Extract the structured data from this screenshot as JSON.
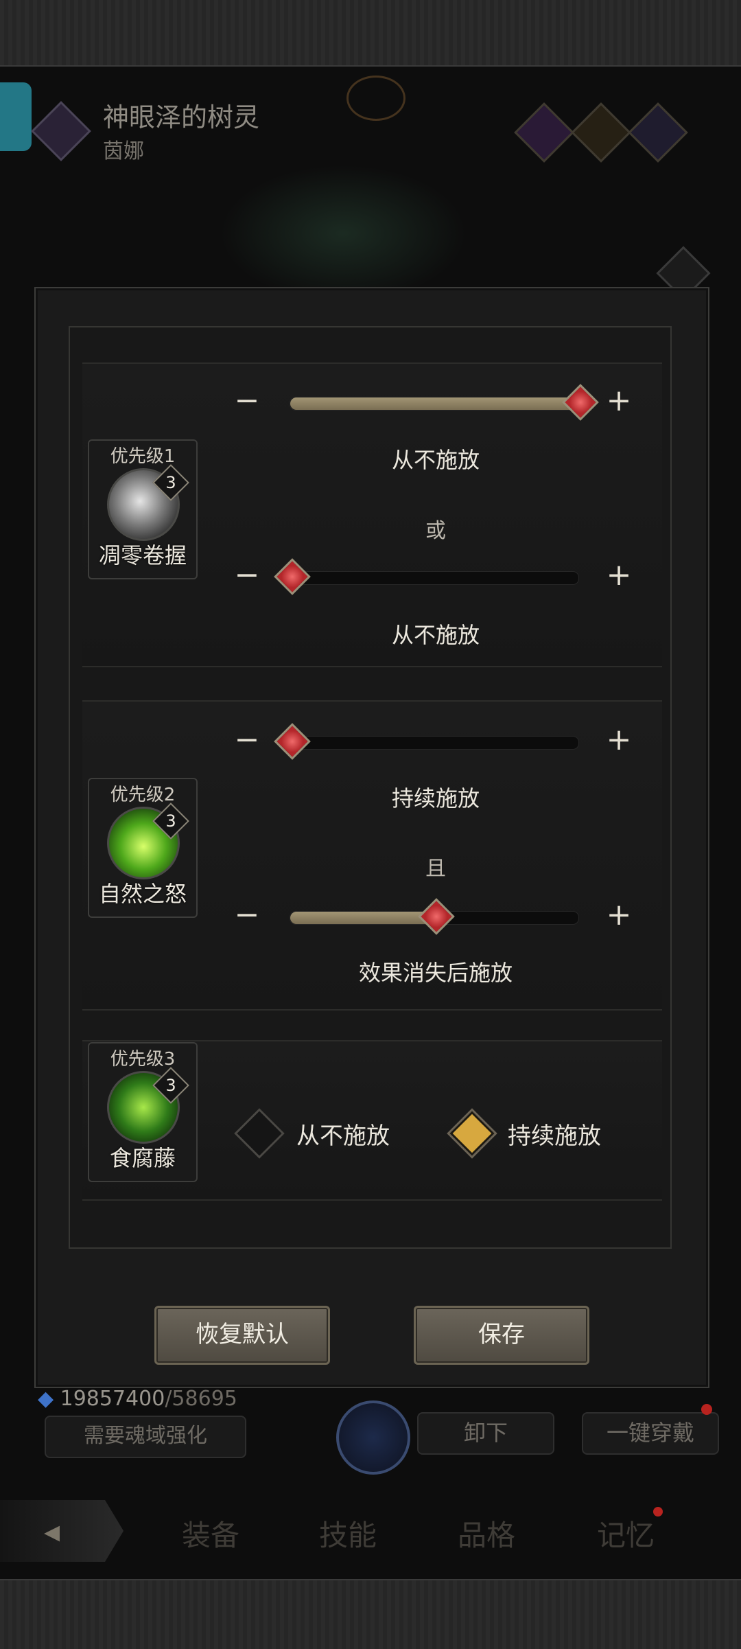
{
  "header": {
    "title": "神眼泽的树灵",
    "subtitle": "茵娜"
  },
  "dialog": {
    "skills": [
      {
        "priority": "优先级1",
        "level": "3",
        "name": "凋零卷握",
        "icon": "withered-grip-skill-icon",
        "slider1": {
          "value_label": "从不施放",
          "position": 1.0
        },
        "connector": "或",
        "slider2": {
          "value_label": "从不施放",
          "position": 0.0
        }
      },
      {
        "priority": "优先级2",
        "level": "3",
        "name": "自然之怒",
        "icon": "natures-wrath-skill-icon",
        "slider1": {
          "value_label": "持续施放",
          "position": 0.0
        },
        "connector": "且",
        "slider2": {
          "value_label": "效果消失后施放",
          "position": 0.5
        }
      },
      {
        "priority": "优先级3",
        "level": "3",
        "name": "食腐藤",
        "icon": "carrion-vine-skill-icon",
        "options": [
          {
            "label": "从不施放",
            "checked": false
          },
          {
            "label": "持续施放",
            "checked": true
          }
        ]
      }
    ],
    "minus_symbol": "−",
    "plus_symbol": "+",
    "reset_label": "恢复默认",
    "save_label": "保存"
  },
  "background": {
    "soul_count": "19857400",
    "soul_max": "/58695",
    "need_label": "需要魂域强化",
    "unequip_label": "卸下",
    "equip_all_label": "一键穿戴"
  },
  "nav": {
    "tabs": [
      "装备",
      "技能",
      "品格",
      "记忆"
    ]
  },
  "colors": {
    "accent_gold": "#d7a83f",
    "thumb_red": "#c83238",
    "button_bg": "#5d584e"
  }
}
